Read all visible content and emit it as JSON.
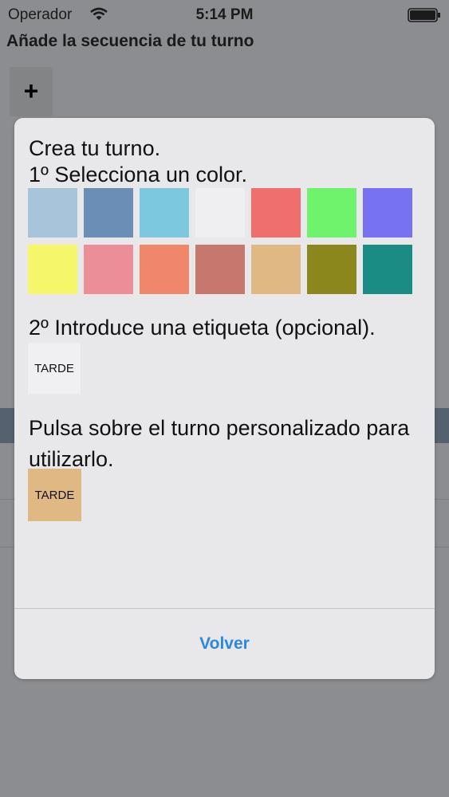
{
  "status_bar": {
    "carrier": "Operador",
    "time": "5:14 PM",
    "wifi_icon": "wifi-icon",
    "battery_icon": "battery-icon"
  },
  "screen": {
    "title": "Añade la secuencia de tu turno",
    "add_label": "+"
  },
  "dialog": {
    "step1_line1": "Crea tu turno.",
    "step1_line2": "1º Selecciona un color.",
    "colors": [
      "#a7c4db",
      "#6b8eb7",
      "#7cc9df",
      "#efeff1",
      "#ef6f6d",
      "#6ff36d",
      "#7672f1",
      "#f6f66b",
      "#ec8e98",
      "#f1876a",
      "#c6776e",
      "#e0b884",
      "#8b871d",
      "#1a8c84"
    ],
    "step2": "2º Introduce una etiqueta (opcional).",
    "label_value": "TARDE",
    "step3": "Pulsa sobre el turno personalizado para utilizarlo.",
    "custom_shift_label": "TARDE",
    "custom_shift_color": "#e0b884",
    "back_label": "Volver",
    "accent_color": "#2a88e0"
  }
}
